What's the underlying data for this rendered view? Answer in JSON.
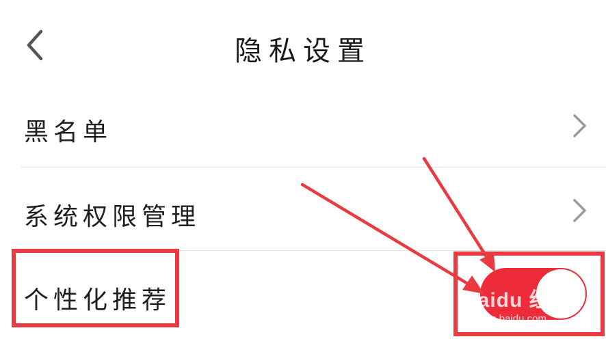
{
  "header": {
    "title": "隐私设置",
    "back_icon": "chevron-left-icon"
  },
  "settings": {
    "blacklist": {
      "label": "黑名单",
      "icon": "chevron-right-icon"
    },
    "permissions": {
      "label": "系统权限管理",
      "icon": "chevron-right-icon"
    },
    "personalized": {
      "label": "个性化推荐",
      "toggle_on": true,
      "toggle_color": "#ee2b3a"
    }
  },
  "annotation": {
    "color": "#e83a40"
  },
  "watermark": {
    "brand": "Baidu 经验",
    "url": "jingyan.baidu.com"
  }
}
